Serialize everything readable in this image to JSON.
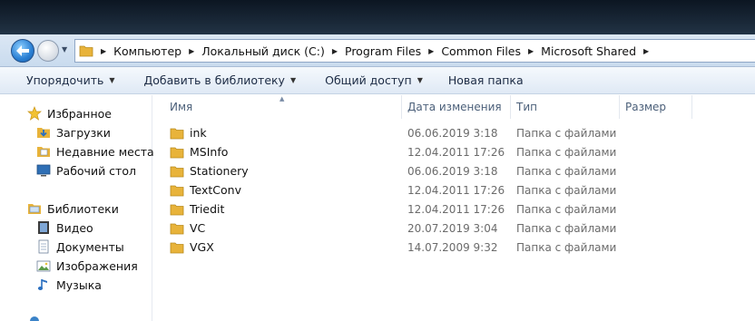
{
  "address": {
    "crumbs": [
      "Компьютер",
      "Локальный диск (C:)",
      "Program Files",
      "Common Files",
      "Microsoft Shared"
    ]
  },
  "toolbar": {
    "organize": "Упорядочить",
    "add_to_library": "Добавить в библиотеку",
    "share": "Общий доступ",
    "new_folder": "Новая папка"
  },
  "sidebar": {
    "favorites_header": "Избранное",
    "favorites": [
      "Загрузки",
      "Недавние места",
      "Рабочий стол"
    ],
    "libraries_header": "Библиотеки",
    "libraries": [
      "Видео",
      "Документы",
      "Изображения",
      "Музыка"
    ]
  },
  "columns": {
    "name": "Имя",
    "date": "Дата изменения",
    "type": "Тип",
    "size": "Размер"
  },
  "files": [
    {
      "name": "ink",
      "date": "06.06.2019 3:18",
      "type": "Папка с файлами"
    },
    {
      "name": "MSInfo",
      "date": "12.04.2011 17:26",
      "type": "Папка с файлами"
    },
    {
      "name": "Stationery",
      "date": "06.06.2019 3:18",
      "type": "Папка с файлами"
    },
    {
      "name": "TextConv",
      "date": "12.04.2011 17:26",
      "type": "Папка с файлами"
    },
    {
      "name": "Triedit",
      "date": "12.04.2011 17:26",
      "type": "Папка с файлами"
    },
    {
      "name": "VC",
      "date": "20.07.2019 3:04",
      "type": "Папка с файлами"
    },
    {
      "name": "VGX",
      "date": "14.07.2009 9:32",
      "type": "Папка с файлами"
    }
  ],
  "colors": {
    "folder": "#e8b33a",
    "accent": "#2a7fd3"
  }
}
